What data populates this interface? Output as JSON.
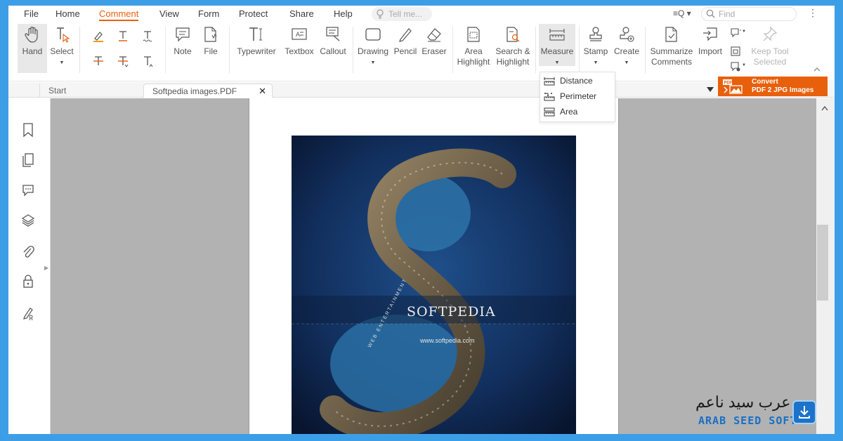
{
  "menu": {
    "items": [
      "File",
      "Home",
      "Comment",
      "View",
      "Form",
      "Protect",
      "Share",
      "Help"
    ],
    "active_index": 2,
    "tell_me_placeholder": "Tell me...",
    "find_placeholder": "Find"
  },
  "ribbon": {
    "hand": "Hand",
    "select": "Select",
    "note": "Note",
    "file": "File",
    "typewriter": "Typewriter",
    "textbox": "Textbox",
    "callout": "Callout",
    "drawing": "Drawing",
    "pencil": "Pencil",
    "eraser": "Eraser",
    "area_highlight_1": "Area",
    "area_highlight_2": "Highlight",
    "search_highlight_1": "Search &",
    "search_highlight_2": "Highlight",
    "measure": "Measure",
    "stamp": "Stamp",
    "create": "Create",
    "summarize_1": "Summarize",
    "summarize_2": "Comments",
    "import": "Import",
    "keep_tool_1": "Keep Tool",
    "keep_tool_2": "Selected"
  },
  "measure_menu": {
    "items": [
      "Distance",
      "Perimeter",
      "Area"
    ]
  },
  "tabs": {
    "start": "Start",
    "file": "Softpedia images.PDF"
  },
  "convert": {
    "line1": "Convert",
    "line2": "PDF 2 JPG Images",
    "color": "#e8600c"
  },
  "document": {
    "image_title": "SOFTPEDIA",
    "image_url": "www.softpedia.com",
    "image_vertical_text": "WEB ENTERTAINMENT"
  },
  "watermark": {
    "arabic": "عرب سيد ناعم",
    "latin": "ARAB SEED SOFT"
  },
  "colors": {
    "accent": "#e8600c",
    "frame": "#3d9ee8"
  }
}
